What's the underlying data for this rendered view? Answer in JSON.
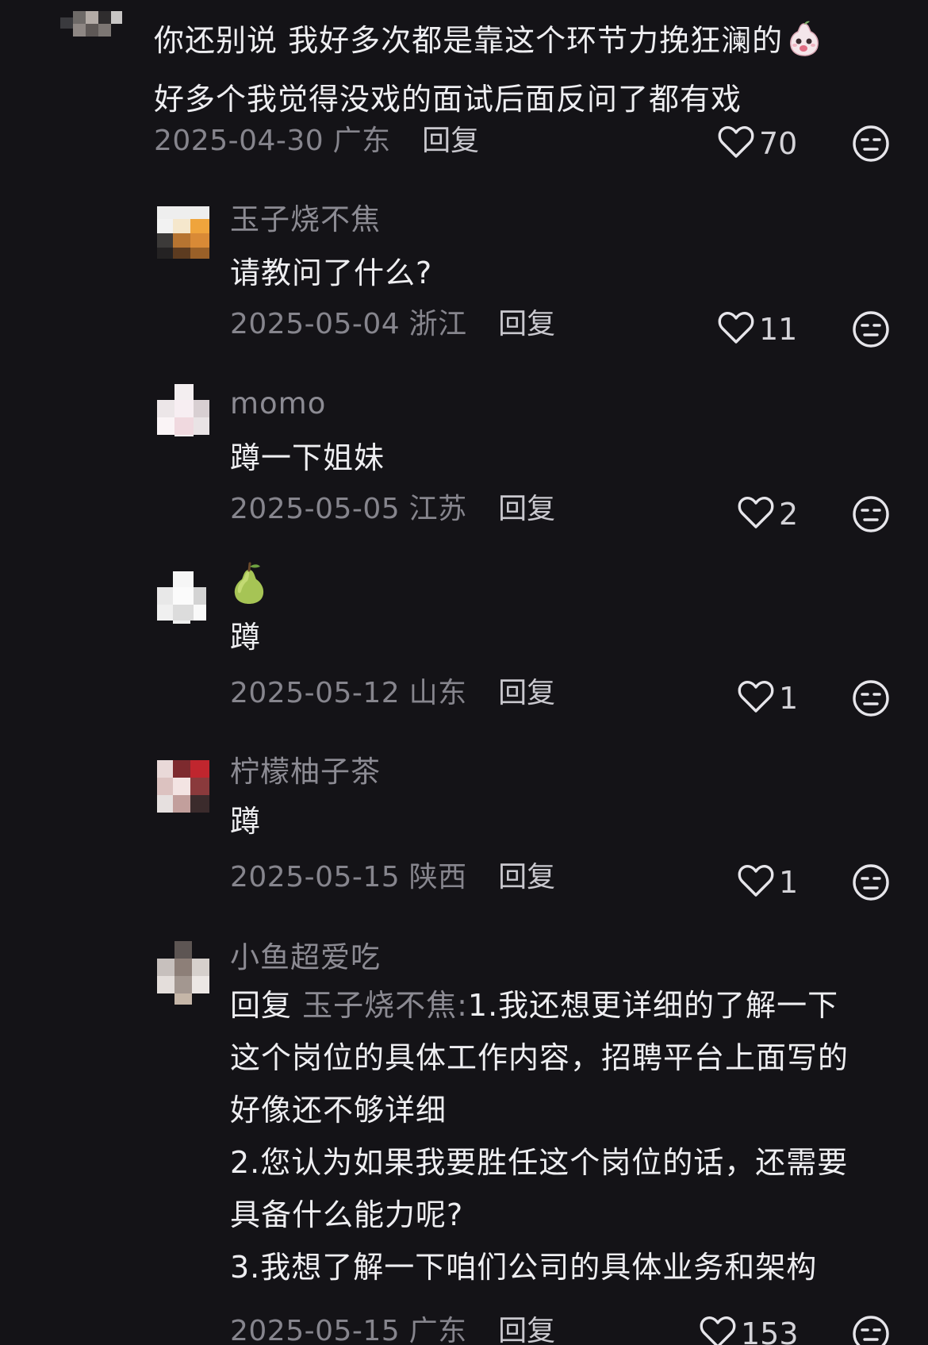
{
  "top_comment": {
    "text_lines": [
      "你还别说 我好多次都是靠这个环节力挽狂澜的",
      "好多个我觉得没戏的面试后面反问了都有戏"
    ],
    "date": "2025-04-30",
    "region": "广东",
    "reply_label": "回复",
    "likes": "70"
  },
  "replies": [
    {
      "username": "玉子烧不焦",
      "text_lines": [
        "请教问了什么?"
      ],
      "date": "2025-05-04",
      "region": "浙江",
      "reply_label": "回复",
      "likes": "11"
    },
    {
      "username": "momo",
      "text_lines": [
        "蹲一下姐妹"
      ],
      "date": "2025-05-05",
      "region": "江苏",
      "reply_label": "回复",
      "likes": "2"
    },
    {
      "username": "",
      "username_icon": "pear-emoji-icon",
      "text_lines": [
        "蹲"
      ],
      "date": "2025-05-12",
      "region": "山东",
      "reply_label": "回复",
      "likes": "1"
    },
    {
      "username": "柠檬柚子茶",
      "text_lines": [
        "蹲"
      ],
      "date": "2025-05-15",
      "region": "陕西",
      "reply_label": "回复",
      "likes": "1"
    },
    {
      "username": "小鱼超爱吃",
      "reply_prefix": "回复",
      "reply_target": "玉子烧不焦:",
      "first_line_rest": "1.我还想更详细的了解一下",
      "text_lines": [
        "这个岗位的具体工作内容，招聘平台上面写的",
        "好像还不够详细",
        "2.您认为如果我要胜任这个岗位的话，还需要",
        "具备什么能力呢?",
        "3.我想了解一下咱们公司的具体业务和架构"
      ],
      "date": "2025-05-15",
      "region": "广东",
      "reply_label": "回复",
      "likes": "153"
    }
  ],
  "colors": {
    "background": "#141317",
    "primary_text": "#eeeef1",
    "secondary_text": "#86858d",
    "username_text": "#8c8b93"
  }
}
